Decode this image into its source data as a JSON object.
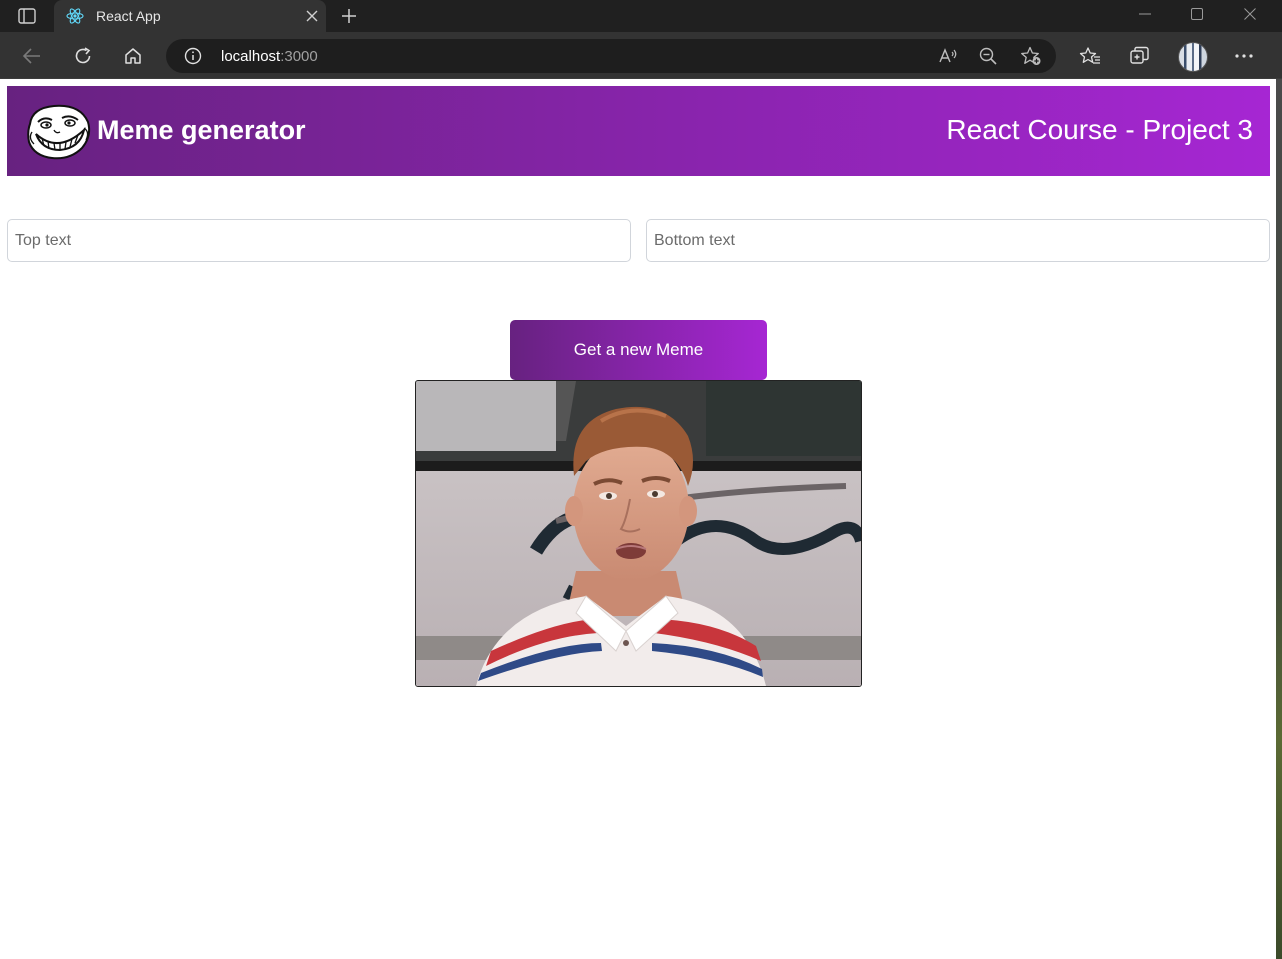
{
  "browser": {
    "tab_title": "React App",
    "address_host": "localhost",
    "address_port": ":3000"
  },
  "header": {
    "brand": "Meme generator",
    "course": "React Course - Project 3"
  },
  "form": {
    "top_placeholder": "Top text",
    "bottom_placeholder": "Bottom text",
    "top_value": "",
    "bottom_value": "",
    "button_label": "Get a new Meme"
  },
  "colors": {
    "gradient_start": "#672280",
    "gradient_end": "#a626d3",
    "chrome_dark": "#202020",
    "chrome_toolbar": "#333333"
  },
  "icons": {
    "tab_actions": "tab-actions-icon",
    "favicon": "react-logo-icon",
    "close": "close-icon",
    "new_tab": "plus-icon",
    "back": "back-arrow-icon",
    "refresh": "refresh-icon",
    "home": "home-icon",
    "site_info": "info-icon",
    "read_aloud": "read-aloud-icon",
    "zoom": "zoom-out-icon",
    "add_favorite": "star-add-icon",
    "favorites": "favorites-icon",
    "collections": "collections-icon",
    "more": "ellipsis-icon",
    "logo": "troll-face-logo"
  }
}
